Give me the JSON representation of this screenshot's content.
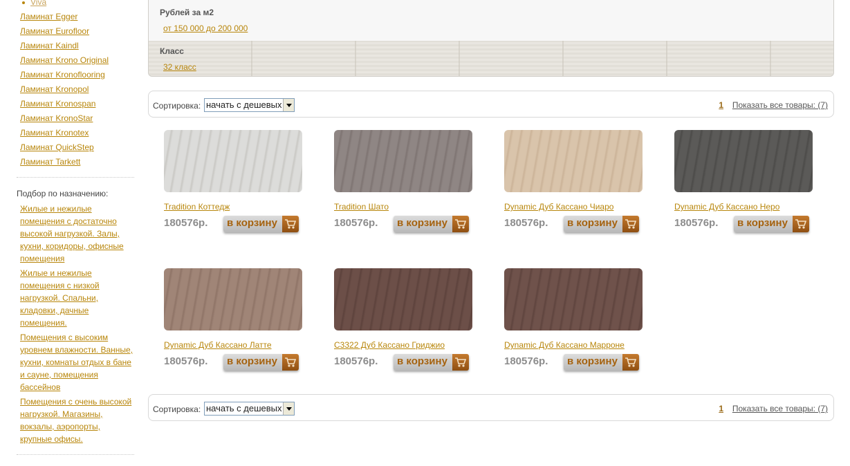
{
  "sidebar": {
    "viva": "Viva",
    "brands": [
      "Ламинат Egger",
      "Ламинат Eurofloor",
      "Ламинат Kaindl",
      "Ламинат Krono Original",
      "Ламинат Kronoflooring",
      "Ламинат Kronopol",
      "Ламинат Kronospan",
      "Ламинат KronoStar",
      "Ламинат Kronotex",
      "Ламинат QuickStep",
      "Ламинат Tarkett"
    ],
    "purpose_title": "Подбор по назначению:",
    "purposes": [
      "Жилые и нежилые помещения с достаточно высокой нагрузкой. Залы, кухни, коридоры, офисные помещения",
      "Жилые и нежилые помещения с низкой нагрузкой. Спальни, кладовки, дачные помещения.",
      "Помещения с высоким уровнем влажности. Ванные, кухни, комнаты отдых в бане и сауне, помещения бассейнов",
      "Помещения с очень высокой нагрузкой. Магазины, вокзалы, аэропорты, крупные офисы."
    ]
  },
  "filters": {
    "price_label": "Рублей за м2",
    "price_value": "от 150 000 до 200 000",
    "class_label": "Класс",
    "class_value": "32 класс"
  },
  "sort": {
    "label": "Сортировка:",
    "selected": "начать с дешевых",
    "page": "1",
    "show_all": "Показать все товары: (7)"
  },
  "cart_label": "в корзину",
  "products": [
    {
      "name": "Tradition Коттедж",
      "price": "180576р.",
      "color": "#dcdcda",
      "grain": "#c9c8c4"
    },
    {
      "name": "Tradition Шато",
      "price": "180576р.",
      "color": "#8f8684",
      "grain": "#7e7472"
    },
    {
      "name": "Dynamic Дуб Кассано Чиаро",
      "price": "180576р.",
      "color": "#d9c4ab",
      "grain": "#cbb398"
    },
    {
      "name": "Dynamic Дуб Кассано Неро",
      "price": "180576р.",
      "color": "#5b5a58",
      "grain": "#4c4b49"
    },
    {
      "name": "Dynamic Дуб Кассано Латте",
      "price": "180576р.",
      "color": "#a08577",
      "grain": "#8f7467"
    },
    {
      "name": "С3322 Дуб Кассано Гриджио",
      "price": "180576р.",
      "color": "#6c4f48",
      "grain": "#5d423c"
    },
    {
      "name": "Dynamic Дуб Кассано Марроне",
      "price": "180576р.",
      "color": "#6f524b",
      "grain": "#5f443e"
    }
  ]
}
